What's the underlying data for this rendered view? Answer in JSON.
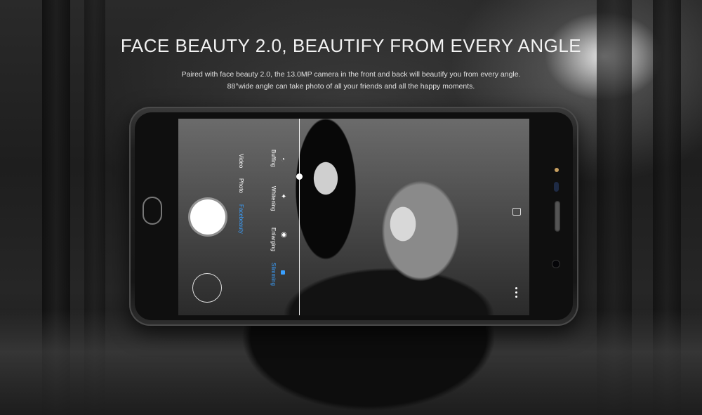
{
  "headline": "FACE BEAUTY 2.0, BEAUTIFY FROM EVERY ANGLE",
  "description": {
    "line1": "Paired with face beauty 2.0, the 13.0MP camera in the front and back will beautify you from every angle.",
    "line2": "88°wide angle can take photo of all your friends and all the happy moments."
  },
  "camera_ui": {
    "modes": [
      "Video",
      "Photo",
      "Facebeauty"
    ],
    "active_mode": "Facebeauty",
    "beauty_options": [
      "Buffing",
      "Whitening",
      "Enlarging",
      "Slimming"
    ],
    "active_option": "Slimming",
    "icons": [
      "shutter-button",
      "gallery-thumbnail",
      "camera-switch-icon",
      "more-options-icon"
    ]
  },
  "colors": {
    "accent": "#3aa0ff",
    "headline": "#f2f2f2"
  }
}
